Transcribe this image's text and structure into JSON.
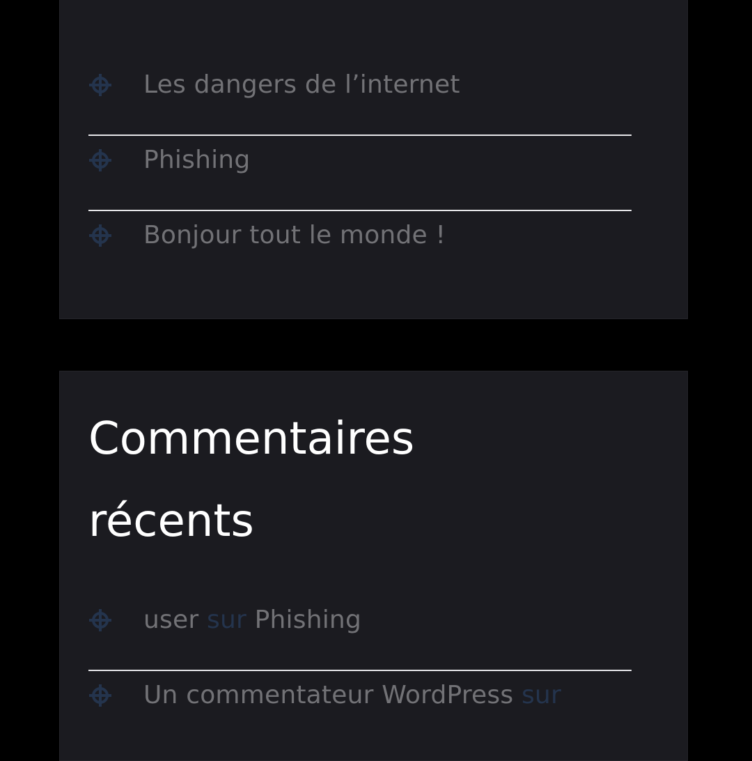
{
  "colors": {
    "page_bg": "#000000",
    "widget_bg": "#1b1b20",
    "text": "#727276",
    "muted_text": "#24344d",
    "heading": "#ffffff",
    "divider": "#e7e7e9",
    "icon": "#24344d"
  },
  "recent_posts": {
    "items": [
      {
        "label": "Les dangers de l’internet",
        "icon": "crosshair-icon"
      },
      {
        "label": "Phishing",
        "icon": "crosshair-icon"
      },
      {
        "label": "Bonjour tout le monde !",
        "icon": "crosshair-icon"
      }
    ]
  },
  "recent_comments": {
    "title_line1": "Commentaires",
    "title_line2": "récents",
    "items": [
      {
        "author": "user",
        "connector": "sur",
        "post": "Phishing",
        "icon": "crosshair-icon"
      },
      {
        "author": "Un commentateur WordPress",
        "connector": "sur",
        "post": "",
        "icon": "crosshair-icon"
      }
    ]
  }
}
